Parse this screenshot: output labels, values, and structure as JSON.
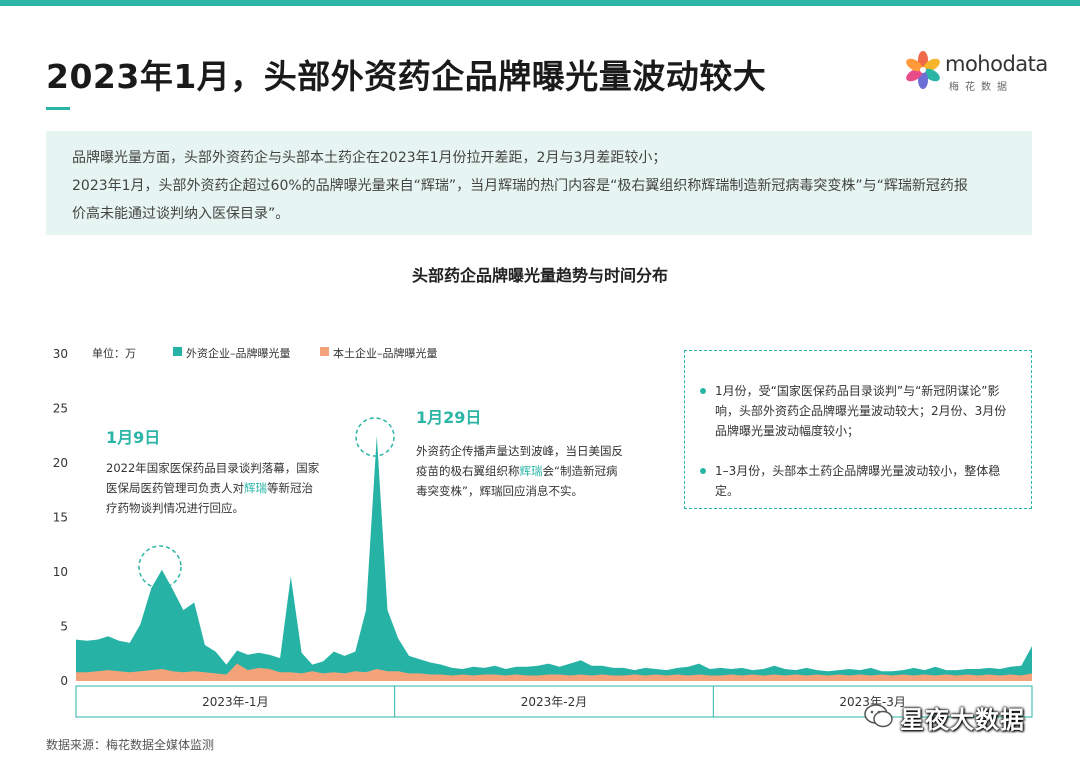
{
  "header": {
    "title": "2023年1月，头部外资药企品牌曝光量波动较大",
    "brand_colors": {
      "accent": "#2bb5a6",
      "foreign": "#26b3a6",
      "domestic": "#f4a279"
    }
  },
  "logo": {
    "name": "mohodata",
    "subtitle": "梅花数据"
  },
  "summary": {
    "line1": "品牌曝光量方面，头部外资药企与头部本土药企在2023年1月份拉开差距，2月与3月差距较小；",
    "line2": "2023年1月，头部外资药企超过60%的品牌曝光量来自“辉瑞”，当月辉瑞的热门内容是“极右翼组织称辉瑞制造新冠病毒突变株”与“辉瑞新冠药报",
    "line3": "价高未能通过谈判纳入医保目录”。"
  },
  "callouts": {
    "jan9": {
      "date": "1月9日",
      "line1": "2022年国家医保药品目录谈判落幕，国家",
      "line2_pre": "医保局医药管理司负责人对",
      "line2_hl": "辉瑞",
      "line2_post": "等新冠治",
      "line3": "疗药物谈判情况进行回应。"
    },
    "jan29": {
      "date": "1月29日",
      "line1": "外资药企传播声量达到波峰，当日美国反",
      "line2_pre": "疫苗的极右翼组织称",
      "line2_hl": "辉瑞",
      "line2_post": "会“制造新冠病",
      "line3": "毒突变株”，辉瑞回应消息不实。"
    }
  },
  "annotation": {
    "item1": "1月份，受“国家医保药品目录谈判”与“新冠阴谋论”影响，头部外资药企品牌曝光量波动较大；2月份、3月份品牌曝光量波动幅度较小；",
    "item2": "1–3月份，头部本土药企品牌曝光量波动较小，整体稳定。"
  },
  "source": "数据来源：梅花数据全媒体监测",
  "watermark": "星夜大数据",
  "chart_data": {
    "type": "area",
    "title": "头部药企品牌曝光量趋势与时间分布",
    "unit_label": "单位：万",
    "ylim": [
      0,
      30
    ],
    "yticks": [
      0,
      5,
      10,
      15,
      20,
      25,
      30
    ],
    "grid": false,
    "legend": "top-left",
    "months": [
      "2023年-1月",
      "2023年-2月",
      "2023年-3月"
    ],
    "x_days": [
      1,
      2,
      3,
      4,
      5,
      6,
      7,
      8,
      9,
      10,
      11,
      12,
      13,
      14,
      15,
      16,
      17,
      18,
      19,
      20,
      21,
      22,
      23,
      24,
      25,
      26,
      27,
      28,
      29,
      30,
      31,
      32,
      33,
      34,
      35,
      36,
      37,
      38,
      39,
      40,
      41,
      42,
      43,
      44,
      45,
      46,
      47,
      48,
      49,
      50,
      51,
      52,
      53,
      54,
      55,
      56,
      57,
      58,
      59,
      60,
      61,
      62,
      63,
      64,
      65,
      66,
      67,
      68,
      69,
      70,
      71,
      72,
      73,
      74,
      75,
      76,
      77,
      78,
      79,
      80,
      81,
      82,
      83,
      84,
      85,
      86,
      87,
      88,
      89,
      90
    ],
    "series": [
      {
        "name": "外资企业–品牌曝光量",
        "color": "#26b3a6",
        "values": [
          3.8,
          3.7,
          3.8,
          4.1,
          3.7,
          3.5,
          5.2,
          8.5,
          10.2,
          8.4,
          6.5,
          7.2,
          3.3,
          2.7,
          1.5,
          2.8,
          2.4,
          2.6,
          2.4,
          2.1,
          9.6,
          2.6,
          1.5,
          1.8,
          2.7,
          2.3,
          2.7,
          6.5,
          22.5,
          6.5,
          3.9,
          2.3,
          2.0,
          1.7,
          1.5,
          1.2,
          1.1,
          1.3,
          1.2,
          1.4,
          1.1,
          1.3,
          1.3,
          1.4,
          1.6,
          1.3,
          1.6,
          1.9,
          1.4,
          1.4,
          1.2,
          1.2,
          1.0,
          1.2,
          1.1,
          1.0,
          1.2,
          1.3,
          1.6,
          1.1,
          1.2,
          1.1,
          1.2,
          1.0,
          1.1,
          1.4,
          1.1,
          1.0,
          1.2,
          1.0,
          0.9,
          1.0,
          1.1,
          1.0,
          1.2,
          0.9,
          0.9,
          1.0,
          1.2,
          1.0,
          1.3,
          1.0,
          1.0,
          1.1,
          1.1,
          1.2,
          1.1,
          1.3,
          1.4,
          3.2
        ]
      },
      {
        "name": "本土企业–品牌曝光量",
        "color": "#f4a279",
        "values": [
          0.8,
          0.8,
          0.9,
          1.0,
          0.9,
          0.8,
          0.9,
          1.0,
          1.1,
          0.9,
          0.8,
          0.9,
          0.8,
          0.7,
          0.6,
          1.6,
          1.0,
          1.2,
          1.1,
          0.8,
          0.8,
          0.7,
          0.9,
          0.7,
          0.8,
          0.7,
          0.9,
          0.8,
          1.1,
          0.9,
          0.9,
          0.7,
          0.7,
          0.6,
          0.6,
          0.5,
          0.6,
          0.5,
          0.6,
          0.6,
          0.5,
          0.6,
          0.5,
          0.5,
          0.6,
          0.6,
          0.5,
          0.6,
          0.5,
          0.6,
          0.5,
          0.5,
          0.6,
          0.5,
          0.6,
          0.5,
          0.6,
          0.5,
          0.6,
          0.5,
          0.5,
          0.6,
          0.5,
          0.6,
          0.5,
          0.6,
          0.5,
          0.6,
          0.5,
          0.6,
          0.5,
          0.6,
          0.5,
          0.6,
          0.5,
          0.6,
          0.5,
          0.6,
          0.5,
          0.6,
          0.5,
          0.6,
          0.5,
          0.6,
          0.5,
          0.6,
          0.5,
          0.6,
          0.5,
          0.7
        ]
      }
    ]
  }
}
